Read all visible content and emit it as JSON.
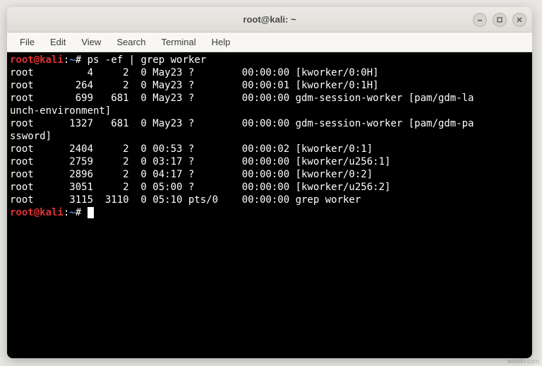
{
  "window": {
    "title": "root@kali: ~"
  },
  "menubar": {
    "items": [
      "File",
      "Edit",
      "View",
      "Search",
      "Terminal",
      "Help"
    ]
  },
  "prompt": {
    "user_host": "root@kali",
    "path": "~",
    "symbol": "#"
  },
  "command": "ps -ef | grep worker",
  "output": [
    "root         4     2  0 May23 ?        00:00:00 [kworker/0:0H]",
    "root       264     2  0 May23 ?        00:00:01 [kworker/0:1H]",
    "root       699   681  0 May23 ?        00:00:00 gdm-session-worker [pam/gdm-la",
    "unch-environment]",
    "root      1327   681  0 May23 ?        00:00:00 gdm-session-worker [pam/gdm-pa",
    "ssword]",
    "root      2404     2  0 00:53 ?        00:00:02 [kworker/0:1]",
    "root      2759     2  0 03:17 ?        00:00:00 [kworker/u256:1]",
    "root      2896     2  0 04:17 ?        00:00:00 [kworker/0:2]",
    "root      3051     2  0 05:00 ?        00:00:00 [kworker/u256:2]",
    "root      3115  3110  0 05:10 pts/0    00:00:00 grep worker"
  ],
  "watermark": "wskdri.com"
}
